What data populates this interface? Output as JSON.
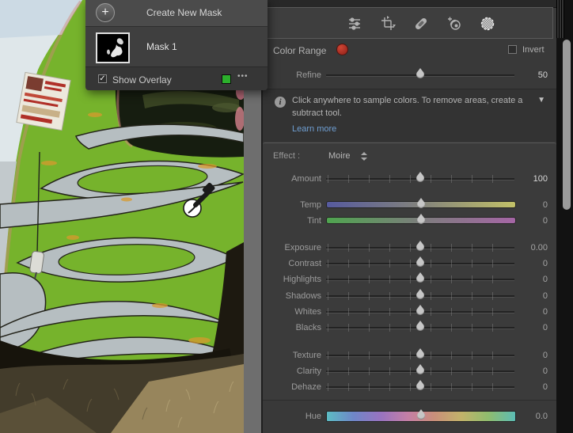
{
  "popup": {
    "create_label": "Create New Mask",
    "plus_icon": "+",
    "mask_item": {
      "name": "Mask 1"
    },
    "show_overlay": {
      "label": "Show Overlay",
      "check_icon": "✓",
      "overlay_color": "#2cb02c",
      "more_icon": "•••"
    }
  },
  "panel": {
    "toolbar": {
      "icons": [
        "adjust-sliders",
        "crop-rotate",
        "healing",
        "red-eye",
        "masking-active"
      ]
    },
    "color_range": {
      "title": "Color Range",
      "sample_color": "#b22d22",
      "invert_label": "Invert",
      "refine": {
        "label": "Refine",
        "value": "50",
        "pos_pct": 50
      }
    },
    "info": {
      "icon": "i",
      "message": "Click anywhere to sample colors. To remove areas, create a subtract tool.",
      "link": "Learn more",
      "collapse_icon": "▼"
    },
    "effect": {
      "label": "Effect :",
      "selected": "Moire"
    },
    "sliders": {
      "amount": {
        "label": "Amount",
        "value": "100",
        "pos_pct": 50
      },
      "temp": {
        "label": "Temp",
        "value": "0",
        "pos_pct": 50,
        "gradient": [
          "#565a9e",
          "#83837c",
          "#c2c168"
        ]
      },
      "tint": {
        "label": "Tint",
        "value": "0",
        "pos_pct": 50,
        "gradient": [
          "#4fa44f",
          "#7d7d7d",
          "#a566a5"
        ]
      },
      "exposure": {
        "label": "Exposure",
        "value": "0.00",
        "pos_pct": 50
      },
      "contrast": {
        "label": "Contrast",
        "value": "0",
        "pos_pct": 50
      },
      "highlights": {
        "label": "Highlights",
        "value": "0",
        "pos_pct": 50
      },
      "shadows": {
        "label": "Shadows",
        "value": "0",
        "pos_pct": 50
      },
      "whites": {
        "label": "Whites",
        "value": "0",
        "pos_pct": 50
      },
      "blacks": {
        "label": "Blacks",
        "value": "0",
        "pos_pct": 50
      },
      "texture": {
        "label": "Texture",
        "value": "0",
        "pos_pct": 50
      },
      "clarity": {
        "label": "Clarity",
        "value": "0",
        "pos_pct": 50
      },
      "dehaze": {
        "label": "Dehaze",
        "value": "0",
        "pos_pct": 50
      },
      "hue": {
        "label": "Hue",
        "value": "0.0",
        "pos_pct": 50,
        "gradient": [
          "#5cbcc4",
          "#6f86c8",
          "#9873c0",
          "#c47fa6",
          "#c98f7a",
          "#c2b36a",
          "#8fbc6e",
          "#5cbcb4"
        ]
      }
    }
  },
  "colors": {
    "mask_overlay_green": "#76b32c",
    "link_blue": "#6f9fd3",
    "sample_red": "#b22d22"
  }
}
